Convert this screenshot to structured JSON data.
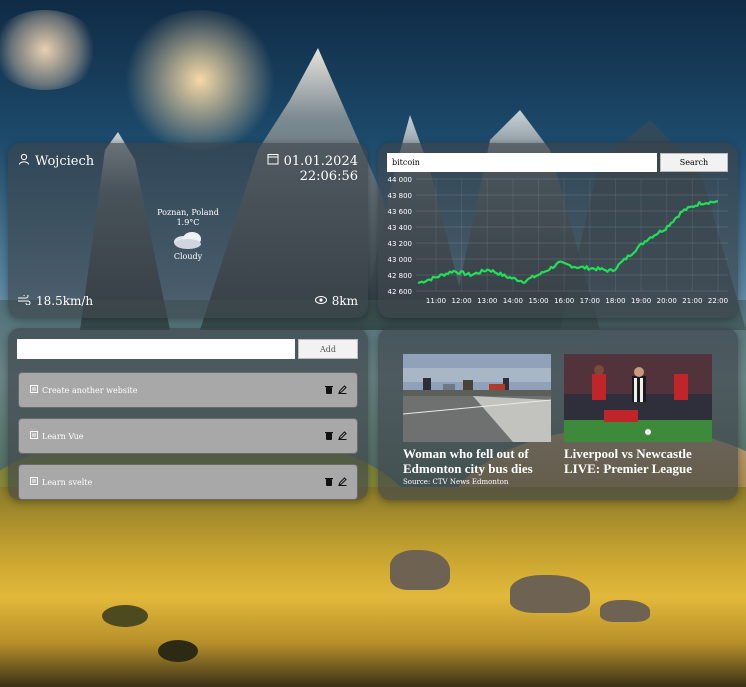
{
  "user": {
    "name": "Wojciech",
    "icon": "user-icon"
  },
  "datetime": {
    "date": "01.01.2024",
    "time": "22:06:56",
    "icon": "calendar-icon"
  },
  "weather": {
    "location": "Poznan, Poland",
    "temperature": "1.9°C",
    "condition": "Cloudy",
    "condition_icon": "cloud-icon",
    "wind": "18.5km/h",
    "wind_icon": "wind-icon",
    "visibility": "8km",
    "visibility_icon": "eye-icon"
  },
  "crypto": {
    "search_value": "bitcoin",
    "search_button": "Search",
    "line_color": "#22e055"
  },
  "chart_data": {
    "type": "line",
    "x": [
      "11:00",
      "12:00",
      "13:00",
      "14:00",
      "15:00",
      "16:00",
      "17:00",
      "18:00",
      "19:00",
      "20:00",
      "21:00",
      "22:00"
    ],
    "series": [
      {
        "values": [
          42700,
          42770,
          42850,
          42800,
          42870,
          42780,
          42720,
          42820,
          42950,
          42900,
          42880,
          42850,
          43050,
          43250,
          43380,
          43600,
          43700,
          43720
        ]
      }
    ],
    "yticks": [
      42600,
      42800,
      43000,
      43200,
      43400,
      43600,
      43800,
      44000
    ],
    "ylim": [
      42600,
      44000
    ],
    "grid": true
  },
  "todo": {
    "input_value": "",
    "add_label": "Add",
    "items": [
      {
        "label": "Create another website"
      },
      {
        "label": "Learn Vue"
      },
      {
        "label": "Learn svelte"
      }
    ]
  },
  "news": {
    "articles": [
      {
        "title": "Woman who fell out of Edmonton city bus dies",
        "source": "Source: CTV News Edmonton"
      },
      {
        "title": "Liverpool vs Newcastle LIVE: Premier League",
        "source": ""
      }
    ]
  }
}
